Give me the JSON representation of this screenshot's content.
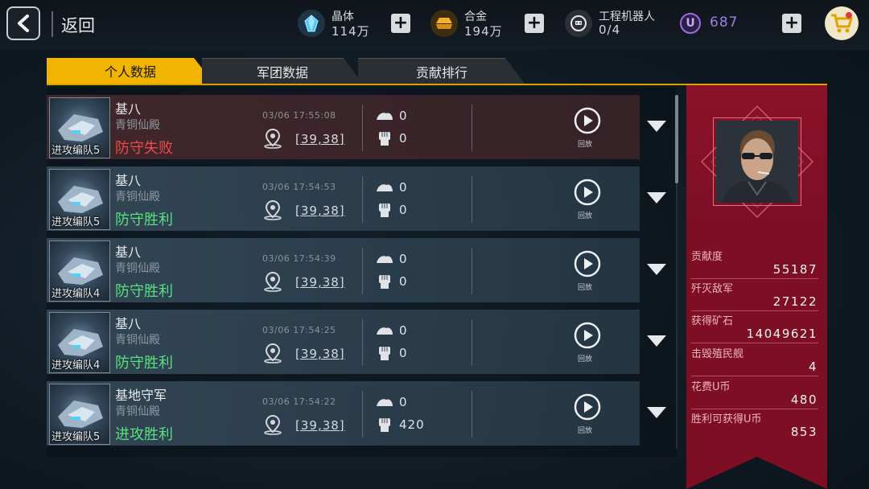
{
  "header": {
    "back_label": "返回",
    "resources": [
      {
        "name": "晶体",
        "value": "114万",
        "icon": "crystal-icon",
        "color": "#4cc6f2"
      },
      {
        "name": "合金",
        "value": "194万",
        "icon": "alloy-icon",
        "color": "#f2b32a"
      },
      {
        "name": "工程机器人",
        "value": "0/4",
        "icon": "robot-icon",
        "color": "#e8e8e8"
      }
    ],
    "ucoin_letter": "U",
    "ucoin_value": "687"
  },
  "tabs": [
    {
      "label": "个人数据",
      "active": true
    },
    {
      "label": "军团数据",
      "active": false
    },
    {
      "label": "贡献排行",
      "active": false
    }
  ],
  "battles": [
    {
      "team": "进攻编队5",
      "name": "基八",
      "server": "青铜仙殿",
      "result": "防守失败",
      "outcome": "lose",
      "time": "03/06 17:55:08",
      "coord": "[39,38]",
      "loss": "0",
      "kills": "0",
      "replay": "回放"
    },
    {
      "team": "进攻编队5",
      "name": "基八",
      "server": "青铜仙殿",
      "result": "防守胜利",
      "outcome": "win",
      "time": "03/06 17:54:53",
      "coord": "[39,38]",
      "loss": "0",
      "kills": "0",
      "replay": "回放"
    },
    {
      "team": "进攻编队4",
      "name": "基八",
      "server": "青铜仙殿",
      "result": "防守胜利",
      "outcome": "win",
      "time": "03/06 17:54:39",
      "coord": "[39,38]",
      "loss": "0",
      "kills": "0",
      "replay": "回放"
    },
    {
      "team": "进攻编队4",
      "name": "基八",
      "server": "青铜仙殿",
      "result": "防守胜利",
      "outcome": "win",
      "time": "03/06 17:54:25",
      "coord": "[39,38]",
      "loss": "0",
      "kills": "0",
      "replay": "回放"
    },
    {
      "team": "进攻编队5",
      "name": "基地守军",
      "server": "青铜仙殿",
      "result": "进攻胜利",
      "outcome": "win",
      "time": "03/06 17:54:22",
      "coord": "[39,38]",
      "loss": "0",
      "kills": "420",
      "replay": "回放"
    }
  ],
  "stats": [
    {
      "label": "贡献度",
      "value": "55187"
    },
    {
      "label": "歼灭敌军",
      "value": "27122"
    },
    {
      "label": "获得矿石",
      "value": "14049621"
    },
    {
      "label": "击毁殖民舰",
      "value": "4"
    },
    {
      "label": "花费U币",
      "value": "480"
    },
    {
      "label": "胜利可获得U币",
      "value": "853"
    }
  ],
  "colors": {
    "accent": "#f1b400",
    "win": "#59e07f",
    "lose": "#ef4848",
    "panel": "#7d0e24"
  }
}
